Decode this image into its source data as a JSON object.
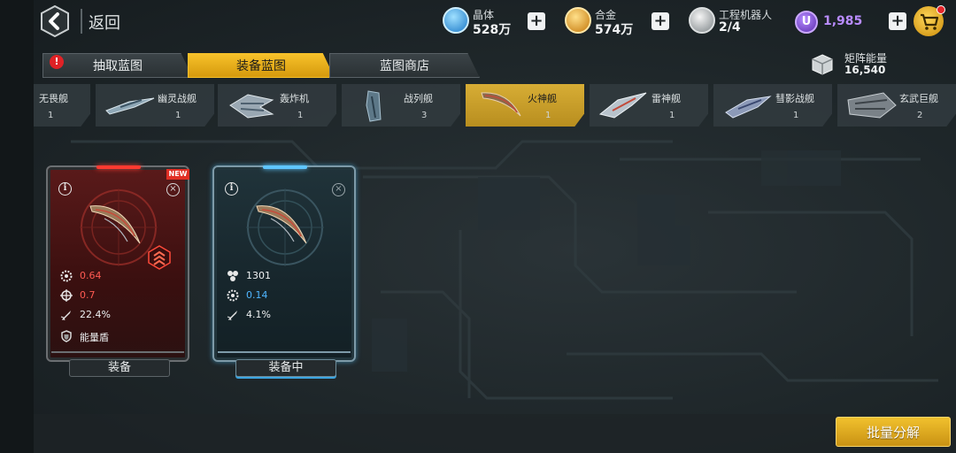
{
  "topbar": {
    "back_label": "返回",
    "resources": [
      {
        "label": "晶体",
        "value": "528万",
        "icon": "crystal-icon",
        "color": "#3fa9f5"
      },
      {
        "label": "合金",
        "value": "574万",
        "icon": "alloy-icon",
        "color": "#f2a30f"
      },
      {
        "label": "工程机器人",
        "value": "2/4",
        "icon": "robot-icon",
        "color": "#d8d8d8"
      }
    ],
    "premium": {
      "letter": "U",
      "value": "1,985"
    }
  },
  "tabs": {
    "items": [
      {
        "label": "抽取蓝图",
        "alert": "!"
      },
      {
        "label": "装备蓝图"
      },
      {
        "label": "蓝图商店"
      }
    ],
    "active_index": 1
  },
  "matrix_energy": {
    "label": "矩阵能量",
    "value": "16,540"
  },
  "ships": [
    {
      "name": "无畏舰",
      "count": "1",
      "name_visible": "无畏舰"
    },
    {
      "name": "幽灵战舰",
      "count": "1"
    },
    {
      "name": "轰炸机",
      "count": "1"
    },
    {
      "name": "战列舰",
      "count": "3"
    },
    {
      "name": "火神舰",
      "count": "1"
    },
    {
      "name": "雷神舰",
      "count": "1"
    },
    {
      "name": "彗影战舰",
      "count": "1"
    },
    {
      "name": "玄武巨舰",
      "count": "2"
    }
  ],
  "cards": [
    {
      "new_tag": "NEW",
      "info": "i",
      "close": "×",
      "stats": [
        {
          "icon": "gear-icon",
          "value": "0.64"
        },
        {
          "icon": "crosshair-icon",
          "value": "0.7"
        },
        {
          "icon": "missile-icon",
          "value": "22.4%"
        },
        {
          "icon": "shield-icon",
          "value": "能量盾"
        }
      ],
      "footer": "装备"
    },
    {
      "info": "i",
      "close": "×",
      "stats": [
        {
          "icon": "cluster-icon",
          "value": "1301"
        },
        {
          "icon": "gear-icon",
          "value": "0.14"
        },
        {
          "icon": "missile-icon",
          "value": "4.1%"
        }
      ],
      "footer": "装备中"
    }
  ],
  "batch_button": "批量分解"
}
